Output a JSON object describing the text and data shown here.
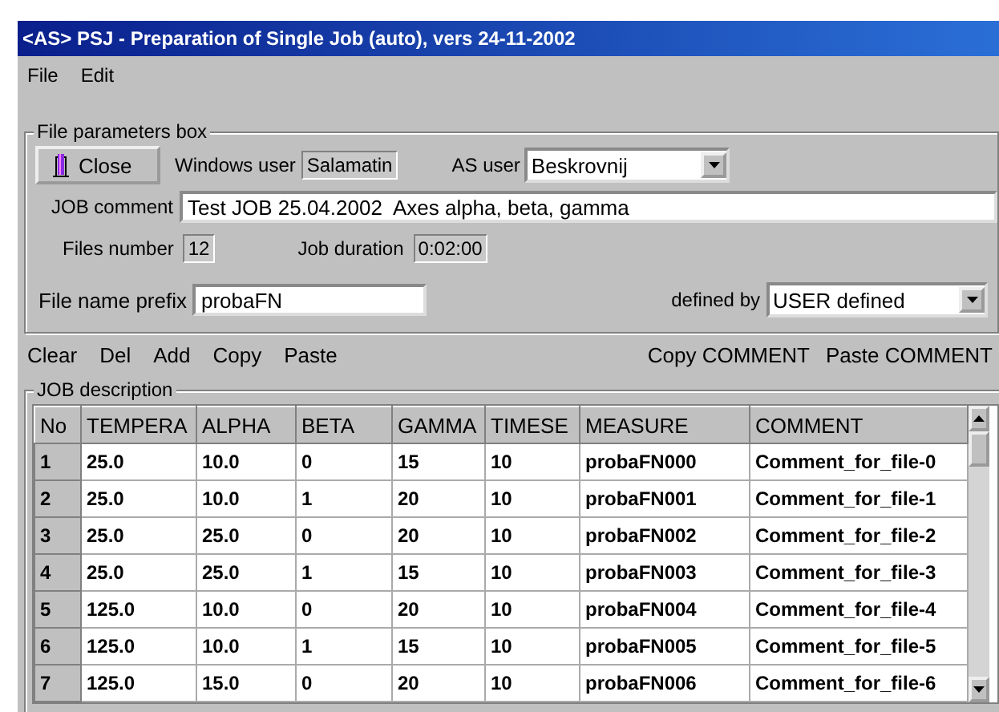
{
  "window": {
    "title": "<AS> PSJ - Preparation of Single Job (auto), vers 24-11-2002"
  },
  "menu": [
    "File",
    "Edit"
  ],
  "file_parameters": {
    "title": "File parameters box",
    "close_button": "Close",
    "windows_user": {
      "label": "Windows user",
      "value": "Salamatin"
    },
    "as_user": {
      "label": "AS user",
      "value": "Beskrovnij"
    },
    "job_comment": {
      "label": "JOB comment",
      "value": "Test JOB 25.04.2002  Axes alpha, beta, gamma"
    },
    "files_number": {
      "label": "Files number",
      "value": "12"
    },
    "job_duration": {
      "label": "Job duration",
      "value": "0:02:00"
    },
    "file_name_prefix": {
      "label": "File name prefix",
      "value": "probaFN"
    },
    "defined_by": {
      "label": "defined by",
      "value": "USER defined"
    }
  },
  "toolbar": {
    "left": [
      "Clear",
      "Del",
      "Add",
      "Copy",
      "Paste"
    ],
    "right": [
      "Copy COMMENT",
      "Paste COMMENT"
    ]
  },
  "job_description": {
    "title": "JOB description",
    "columns": [
      "No",
      "TEMPERA",
      "ALPHA",
      "BETA",
      "GAMMA",
      "TIMESE",
      "MEASURE",
      "COMMENT"
    ],
    "rows": [
      [
        "1",
        "25.0",
        "10.0",
        "0",
        "15",
        "10",
        "probaFN000",
        "Comment_for_file-0"
      ],
      [
        "2",
        "25.0",
        "10.0",
        "1",
        "20",
        "10",
        "probaFN001",
        "Comment_for_file-1"
      ],
      [
        "3",
        "25.0",
        "25.0",
        "0",
        "20",
        "10",
        "probaFN002",
        "Comment_for_file-2"
      ],
      [
        "4",
        "25.0",
        "25.0",
        "1",
        "15",
        "10",
        "probaFN003",
        "Comment_for_file-3"
      ],
      [
        "5",
        "125.0",
        "10.0",
        "0",
        "20",
        "10",
        "probaFN004",
        "Comment_for_file-4"
      ],
      [
        "6",
        "125.0",
        "10.0",
        "1",
        "15",
        "10",
        "probaFN005",
        "Comment_for_file-5"
      ],
      [
        "7",
        "125.0",
        "15.0",
        "0",
        "20",
        "10",
        "probaFN006",
        "Comment_for_file-6"
      ]
    ]
  }
}
